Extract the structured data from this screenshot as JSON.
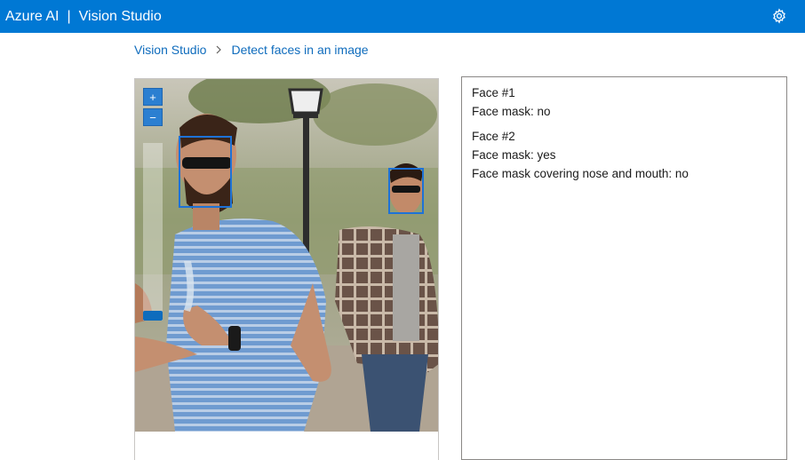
{
  "header": {
    "brand": "Azure AI",
    "separator": "|",
    "app_title": "Vision Studio",
    "settings_icon": "gear-icon"
  },
  "breadcrumb": {
    "home": "Vision Studio",
    "separator_icon": "chevron-right-icon",
    "current": "Detect faces in an image"
  },
  "image_viewer": {
    "zoom_in_label": "+",
    "zoom_out_label": "−",
    "zoom_level": 0.05,
    "detected_faces_count": 2
  },
  "results": [
    {
      "title": "Face #1",
      "lines": [
        "Face mask: no"
      ]
    },
    {
      "title": "Face #2",
      "lines": [
        "Face mask: yes",
        "Face mask covering nose and mouth: no"
      ]
    }
  ],
  "colors": {
    "header_bg": "#0078d4",
    "link": "#0f6cbd",
    "face_box": "#1e72d6"
  }
}
